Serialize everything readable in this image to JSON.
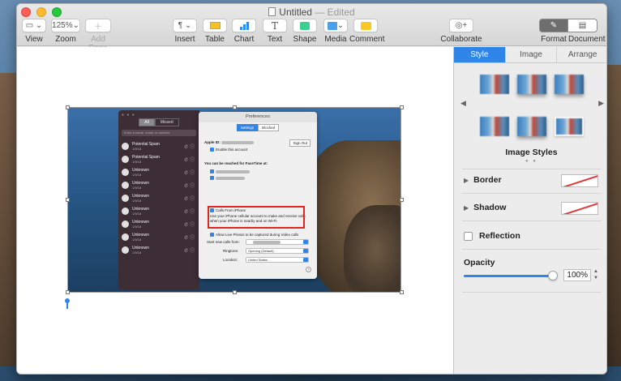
{
  "window": {
    "title": "Untitled",
    "title_suffix": "— Edited"
  },
  "toolbar": {
    "view_label": "View",
    "zoom_value": "125%",
    "zoom_label": "Zoom",
    "add_page_label": "Add Page",
    "insert_label": "Insert",
    "table_label": "Table",
    "chart_label": "Chart",
    "text_label": "Text",
    "shape_label": "Shape",
    "media_label": "Media",
    "comment_label": "Comment",
    "collaborate_label": "Collaborate",
    "format_label": "Format",
    "document_label": "Document"
  },
  "sidebar": {
    "tabs": [
      "Style",
      "Image",
      "Arrange"
    ],
    "active_tab": "Style",
    "image_styles_label": "Image Styles",
    "border_label": "Border",
    "shadow_label": "Shadow",
    "reflection_label": "Reflection",
    "opacity_label": "Opacity",
    "opacity_value": "100%",
    "opacity_fraction": 1.0
  },
  "facetime": {
    "seg_all": "All",
    "seg_missed": "Missed",
    "search_placeholder": "Enter a name, email, or number",
    "calls": [
      {
        "name": "Potential Spam",
        "date": "1/9/18"
      },
      {
        "name": "Potential Spam",
        "date": "1/9/18"
      },
      {
        "name": "Unknown",
        "date": "1/9/18"
      },
      {
        "name": "Unknown",
        "date": "1/9/18"
      },
      {
        "name": "Unknown",
        "date": "1/9/18"
      },
      {
        "name": "Unknown",
        "date": "1/9/18"
      },
      {
        "name": "Unknown",
        "date": "1/9/18"
      },
      {
        "name": "Unknown",
        "date": "1/9/18"
      },
      {
        "name": "Unknown",
        "date": "1/9/18"
      }
    ]
  },
  "prefs": {
    "title": "Preferences",
    "tab_settings": "Settings",
    "tab_blocked": "Blocked",
    "apple_id_label": "Apple ID:",
    "sign_out": "Sign Out",
    "enable_account": "Enable this account",
    "reached_at": "You can be reached for FaceTime at:",
    "calls_from_iphone": "Calls From iPhone",
    "calls_from_iphone_desc": "Use your iPhone cellular account to make and receive calls when your iPhone is nearby and on Wi-Fi.",
    "live_photos": "Allow Live Photos to be captured during Video calls",
    "start_new_calls": "Start new calls from:",
    "ringtone_label": "Ringtone:",
    "ringtone_value": "Opening (Default)",
    "location_label": "Location:",
    "location_value": "United States"
  },
  "colors": {
    "accent": "#2f86e8",
    "highlight": "#e0261f"
  }
}
